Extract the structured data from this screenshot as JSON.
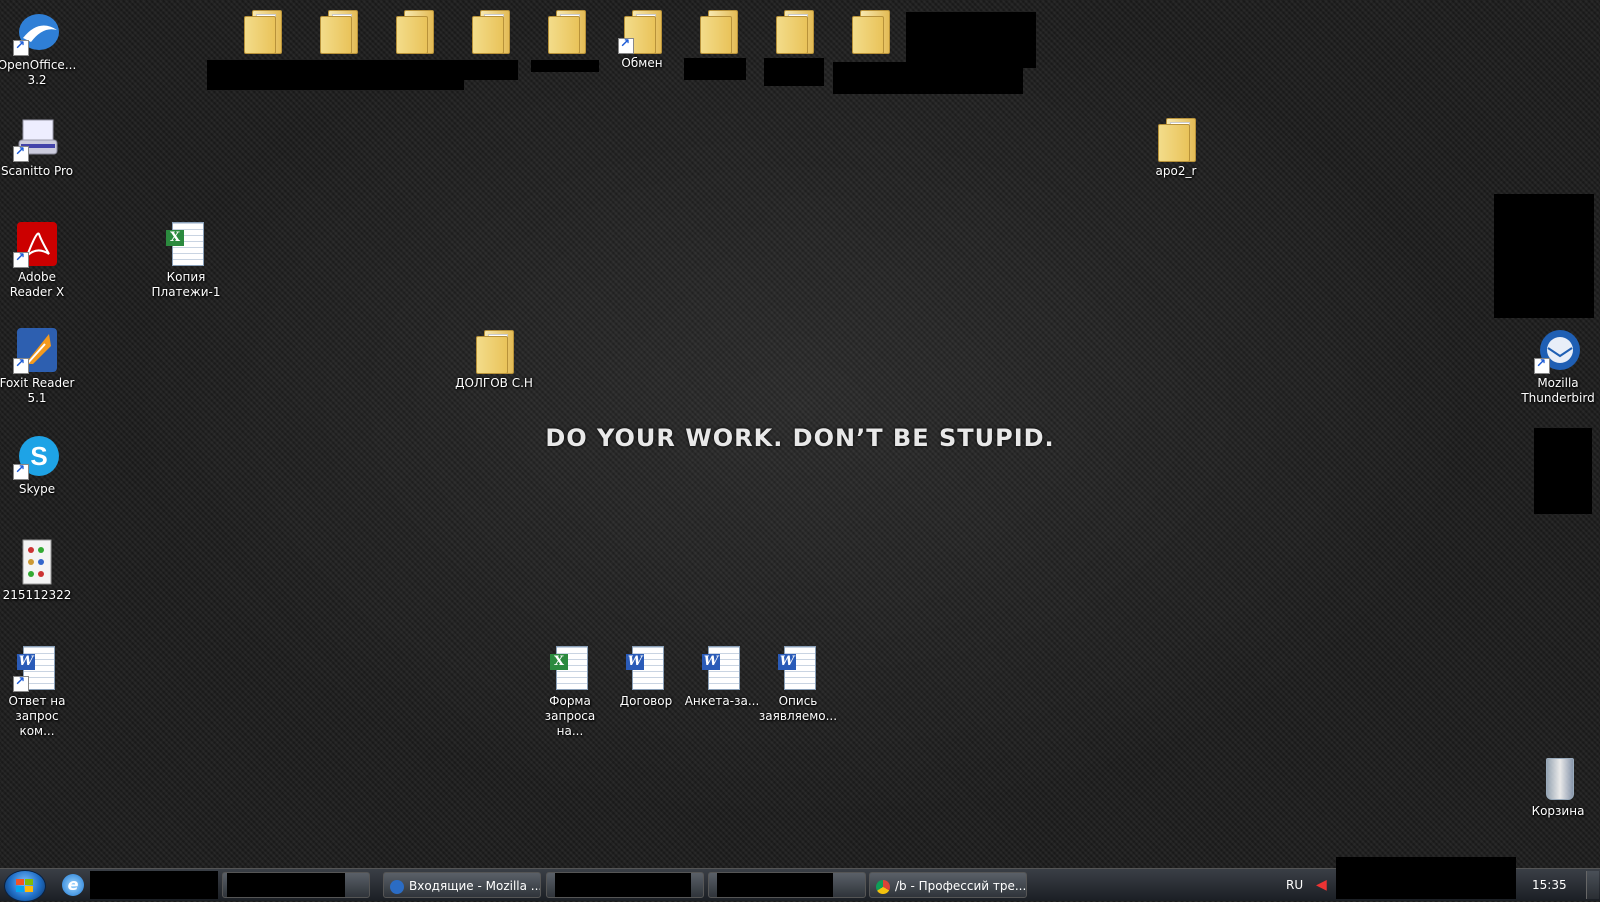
{
  "wallpaper": {
    "motto": "DO YOUR WORK. DON’T BE STUPID."
  },
  "icons": {
    "openoffice": "OpenOffice... 3.2",
    "scanitto": "Scanitto Pro",
    "adobe": "Adobe Reader X",
    "foxit": "Foxit Reader 5.1",
    "skype": "Skype",
    "image215": "215112322",
    "otvet": "Ответ на запрос ком...",
    "kopiya": "Копия Платежи-1",
    "dolgov": "ДОЛГОВ С.Н",
    "obmen": "Обмен",
    "apo2": "apo2_r",
    "thunderbird": "Mozilla Thunderbird",
    "forma": "Форма запроса на...",
    "dogovor": "Договор",
    "anketa": "Анкета-за...",
    "opis": "Опись заявляемо...",
    "korzina": "Корзина"
  },
  "taskbar": {
    "thunderbird_btn": "Входящие - Mozilla ...",
    "chrome_btn": "/b - Профессий тре...",
    "lang": "RU",
    "clock": "15:35"
  },
  "colors": {
    "taskbar": "#2a2f35",
    "accent_word": "#2a5bb8",
    "accent_excel": "#2b8a3e"
  }
}
